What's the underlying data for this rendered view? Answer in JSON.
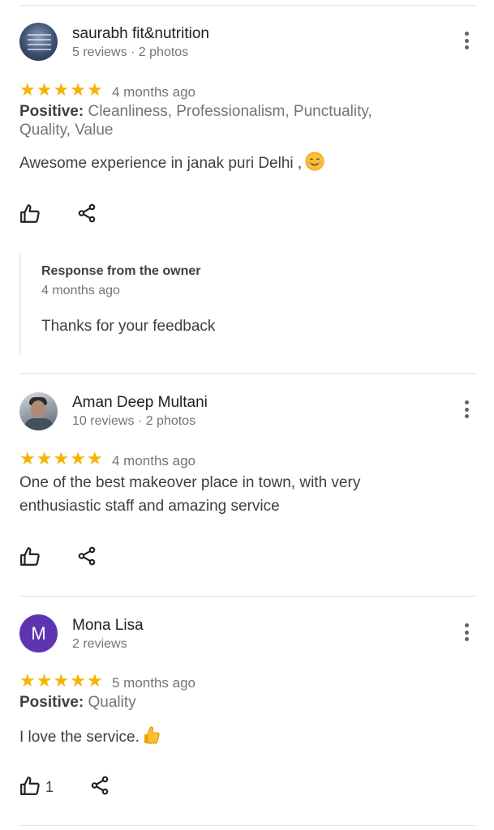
{
  "reviews": [
    {
      "name": "saurabh fit&nutrition",
      "meta": "5 reviews · 2 photos",
      "age": "4 months ago",
      "attr_label": "Positive:",
      "attr_text": " Cleanliness, Professionalism, Punctuality, Quality, Value",
      "text": "Awesome experience in janak puri Delhi ,",
      "emoji": "smiling-face-emoji",
      "owner_response": {
        "title": "Response from the owner",
        "age": "4 months ago",
        "text": "Thanks for your feedback"
      }
    },
    {
      "name": "Aman Deep Multani",
      "meta": "10 reviews · 2 photos",
      "age": "4 months ago",
      "text": "One of the best makeover place in town, with very enthusiastic staff and amazing service"
    },
    {
      "name": "Mona Lisa",
      "avatar_letter": "M",
      "meta": "2 reviews",
      "age": "5 months ago",
      "attr_label": "Positive:",
      "attr_text": " Quality",
      "text": "I love the service.",
      "emoji": "thumbs-up-emoji",
      "like_count": "1"
    }
  ],
  "star_rating": 5,
  "colors": {
    "star": "#f4b400",
    "avatar_letter_bg": "#5e35b1",
    "secondary_text": "#70757a"
  },
  "icons": [
    "more-vert-icon",
    "thumb-up-icon",
    "share-icon"
  ]
}
